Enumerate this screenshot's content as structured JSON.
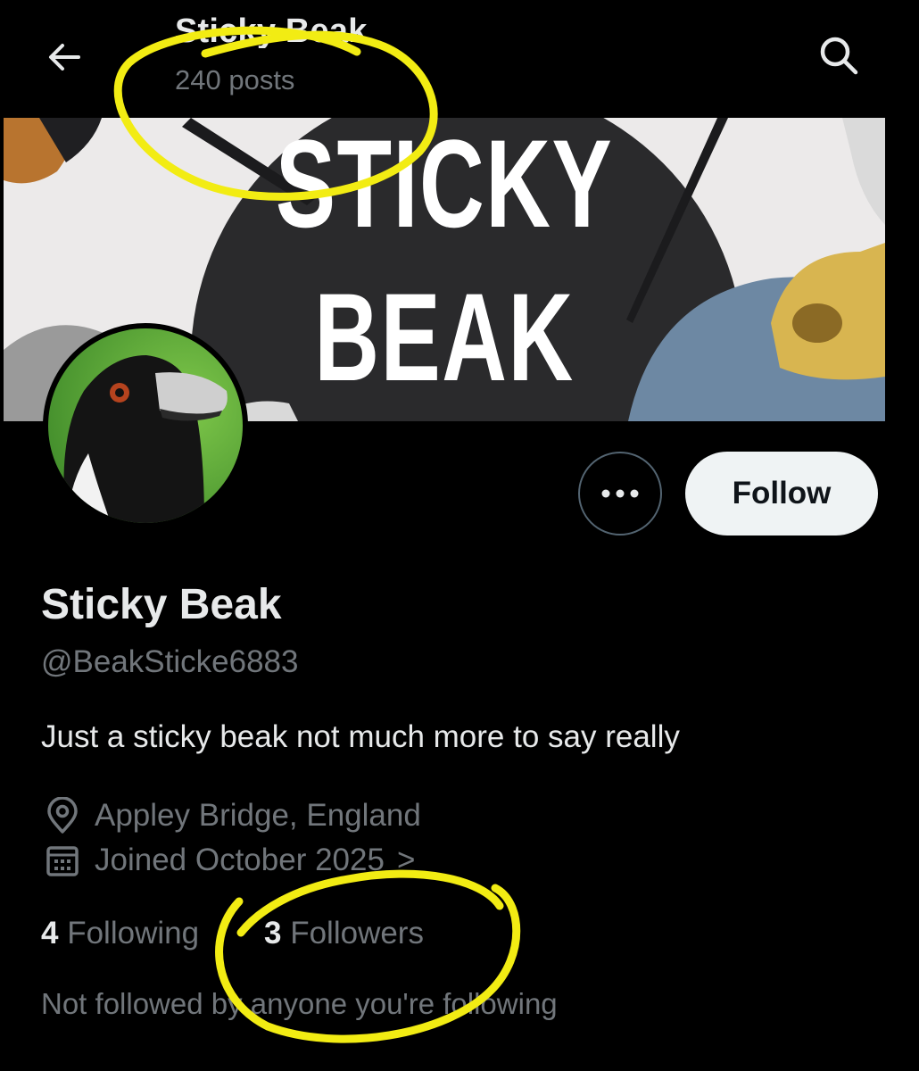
{
  "header": {
    "title": "Sticky Beak",
    "posts_count": "240 posts",
    "back_icon": "arrow-left-icon",
    "search_icon": "search-icon"
  },
  "banner": {
    "line1": "STICKY",
    "line2": "BEAK"
  },
  "profile": {
    "display_name": "Sticky Beak",
    "handle": "@BeakSticke6883",
    "bio": "Just a sticky beak not much more to say really",
    "location": "Appley Bridge, England",
    "joined": "Joined October 2025",
    "joined_chevron": ">",
    "following_count": "4",
    "following_label": "Following",
    "followers_count": "3",
    "followers_label": "Followers",
    "mutuals_note": "Not followed by anyone you're following"
  },
  "actions": {
    "more_icon": "more-horizontal-icon",
    "follow_label": "Follow"
  },
  "colors": {
    "background": "#000000",
    "primary_text": "#e7e9ea",
    "secondary_text": "#71767b",
    "follow_button_bg": "#eff3f4",
    "annotation": "#f2ec13"
  }
}
